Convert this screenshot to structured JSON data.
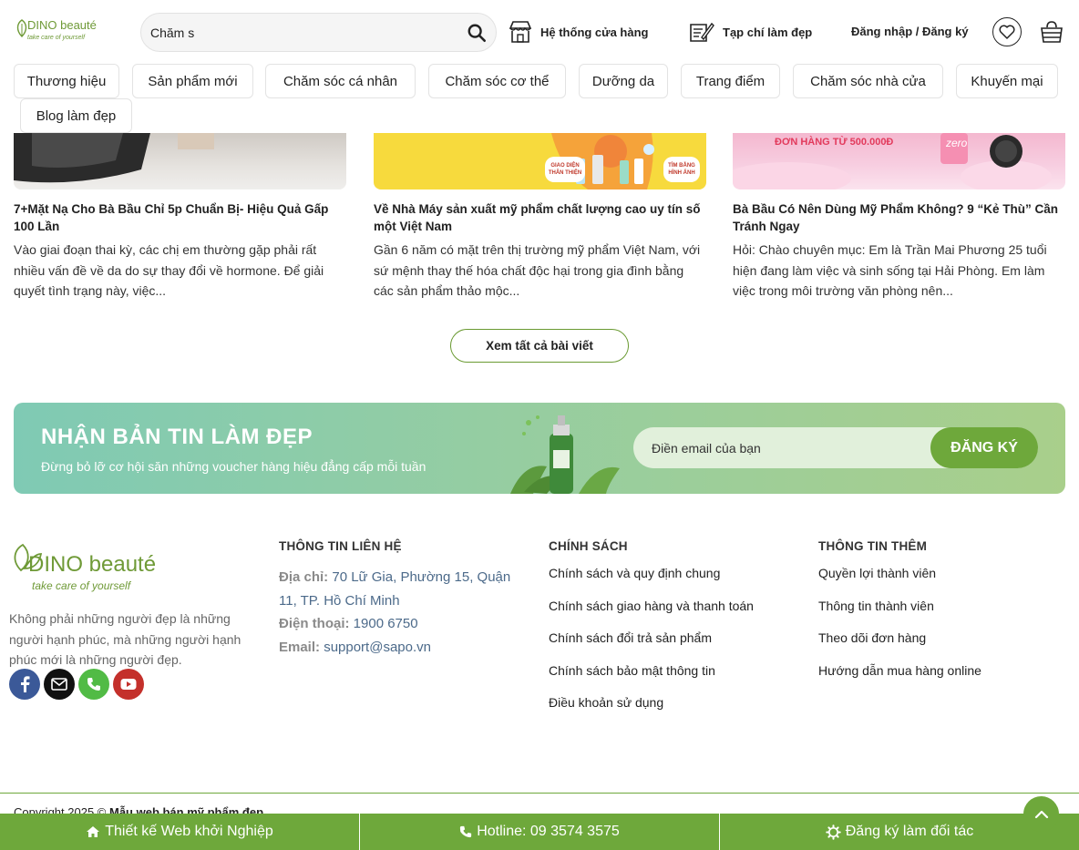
{
  "header": {
    "logo_text": "DINO beauté",
    "logo_tagline": "take care of yourself",
    "search_value": "Chăm s",
    "store_system": "Hệ thống cửa hàng",
    "beauty_magazine": "Tạp chí làm đẹp",
    "login_register": "Đăng nhập / Đăng ký"
  },
  "categories": [
    "Thương hiệu",
    "Sản phẩm mới",
    "Chăm sóc cá nhân",
    "Chăm sóc cơ thể",
    "Dưỡng da",
    "Trang điểm",
    "Chăm sóc nhà cửa",
    "Khuyến mại",
    "Blog làm đẹp"
  ],
  "articles": [
    {
      "title": "7+Mặt Nạ Cho Bà Bầu Chỉ 5p Chuẩn Bị- Hiệu Quả Gấp 100 Lần",
      "desc": "Vào giai đoạn thai kỳ, các chị em thường gặp phải rất nhiều vấn đề về da do sự thay đổi về hormone. Để giải quyết tình trạng này, việc..."
    },
    {
      "title": "Về Nhà Máy sản xuất mỹ phẩm chất lượng cao uy tín số một Việt Nam",
      "desc": "Gần 6 năm có mặt trên thị trường mỹ phẩm Việt Nam, với sứ mệnh thay thế hóa chất độc hại trong gia đình bằng các sản phẩm thảo mộc...",
      "thumb_labels": [
        "GIAO DIỆN THÂN THIỆN",
        "TÌM BẰNG HÌNH ẢNH"
      ]
    },
    {
      "title": "Bà Bầu Có Nên Dùng Mỹ Phẩm Không? 9 “Kẻ Thù” Cần Tránh Ngay",
      "desc": "Hỏi: Chào chuyên mục: Em là Trần Mai Phương 25 tuổi hiện đang làm việc và sinh sống tại Hải Phòng. Em làm việc trong môi trường văn phòng nên...",
      "thumb_labels": [
        "ĐƠN HÀNG TỪ 500.000Đ",
        "zero"
      ]
    }
  ],
  "view_all": "Xem tất cả bài viết",
  "newsletter": {
    "title": "NHẬN BẢN TIN LÀM ĐẸP",
    "subtitle": "Đừng bỏ lỡ cơ hội săn những voucher hàng hiệu đẳng cấp mỗi tuần",
    "placeholder": "Điền email của bạn",
    "button": "ĐĂNG KÝ"
  },
  "footer": {
    "logo_main": "DINO beauté",
    "logo_tagline": "take care of yourself",
    "about": "Không phải những người đẹp là những người hạnh phúc, mà những người hạnh phúc mới là những người đẹp.",
    "contact": {
      "heading": "THÔNG TIN LIÊN HỆ",
      "address_label": "Địa chỉ:",
      "address": "70 Lữ Gia, Phường 15, Quận 11, TP. Hồ Chí Minh",
      "phone_label": "Điện thoại:",
      "phone": "1900 6750",
      "email_label": "Email:",
      "email": "support@sapo.vn"
    },
    "policy": {
      "heading": "CHÍNH SÁCH",
      "links": [
        "Chính sách và quy định chung",
        "Chính sách giao hàng và thanh toán",
        "Chính sách đổi trả sản phẩm",
        "Chính sách bảo mật thông tin",
        "Điều khoản sử dụng"
      ]
    },
    "more": {
      "heading": "THÔNG TIN THÊM",
      "links": [
        "Quyền lợi thành viên",
        "Thông tin thành viên",
        "Theo dõi đơn hàng",
        "Hướng dẫn mua hàng online"
      ]
    },
    "copyright_prefix": "Copyright 2025 ©",
    "copyright_site": "Mẫu web bán mỹ phẩm đẹp"
  },
  "bottom_bar": {
    "startup": "Thiết kế Web khởi Nghiệp",
    "hotline": "Hotline: 09 3574 3575",
    "partner": "Đăng ký làm đối tác"
  },
  "colors": {
    "brand_green": "#6ea83b",
    "logo_green": "#6f9a37",
    "link_blue": "#4c6a8a"
  }
}
